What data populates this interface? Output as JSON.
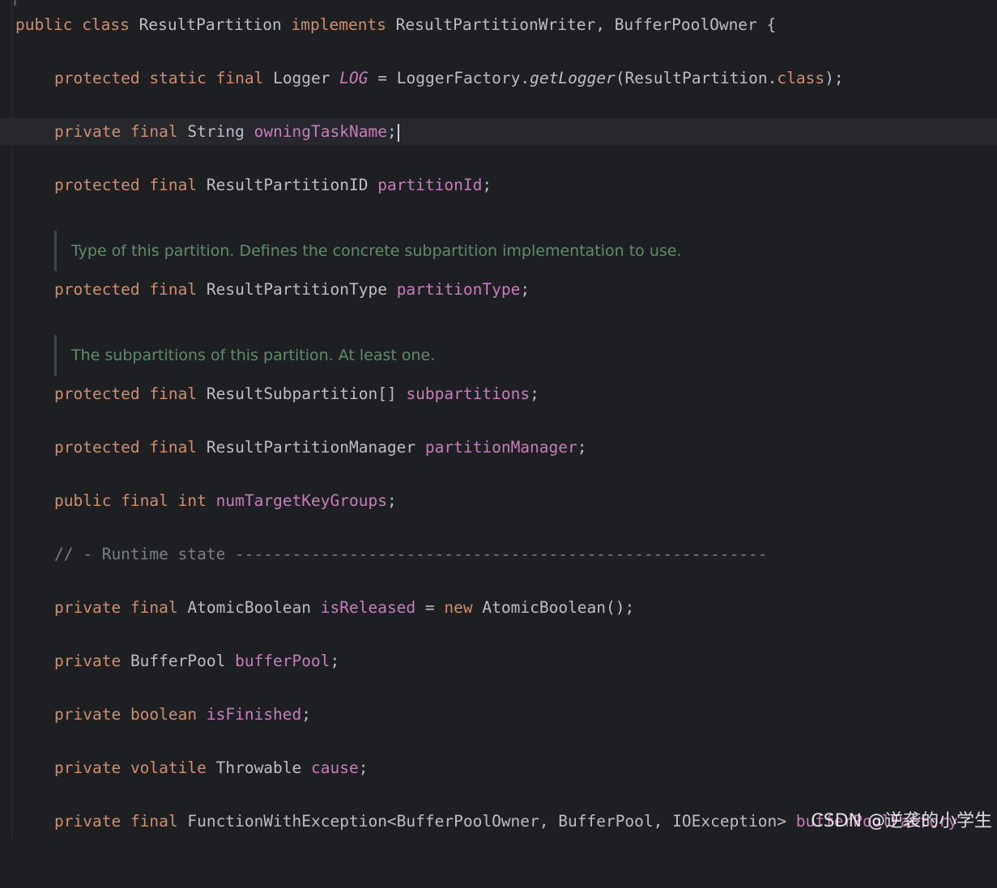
{
  "editor": {
    "l1": {
      "a": "public",
      "b": "class",
      "c": "ResultPartition",
      "d": "implements",
      "e": "ResultPartitionWriter, BufferPoolOwner {"
    },
    "l2": {
      "a": "protected",
      "b": "static",
      "c": "final",
      "d": "Logger",
      "e": "LOG",
      "f": "=",
      "g": "LoggerFactory.",
      "h": "getLogger",
      "i": "(ResultPartition.",
      "j": "class",
      "k": ");"
    },
    "l3": {
      "a": "private",
      "b": "final",
      "c": "String",
      "d": "owningTaskName",
      "e": ";"
    },
    "l4": {
      "a": "protected",
      "b": "final",
      "c": "ResultPartitionID",
      "d": "partitionId",
      "e": ";"
    },
    "doc1": "Type of this partition. Defines the concrete subpartition implementation to use.",
    "l5": {
      "a": "protected",
      "b": "final",
      "c": "ResultPartitionType",
      "d": "partitionType",
      "e": ";"
    },
    "doc2": "The subpartitions of this partition. At least one.",
    "l6": {
      "a": "protected",
      "b": "final",
      "c": "ResultSubpartition[]",
      "d": "subpartitions",
      "e": ";"
    },
    "l7": {
      "a": "protected",
      "b": "final",
      "c": "ResultPartitionManager",
      "d": "partitionManager",
      "e": ";"
    },
    "l8": {
      "a": "public",
      "b": "final",
      "c": "int",
      "d": "numTargetKeyGroups",
      "e": ";"
    },
    "l9": "// - Runtime state --------------------------------------------------------",
    "l10": {
      "a": "private",
      "b": "final",
      "c": "AtomicBoolean",
      "d": "isReleased",
      "e": "=",
      "f": "new",
      "g": "AtomicBoolean();"
    },
    "l11": {
      "a": "private",
      "b": "BufferPool",
      "c": "bufferPool",
      "d": ";"
    },
    "l12": {
      "a": "private",
      "b": "boolean",
      "c": "isFinished",
      "d": ";"
    },
    "l13": {
      "a": "private",
      "b": "volatile",
      "c": "Throwable",
      "d": "cause",
      "e": ";"
    },
    "l14": {
      "a": "private",
      "b": "final",
      "c": "FunctionWithException<BufferPoolOwner, BufferPool, IOException>",
      "d": "bufferPoolFactory"
    }
  },
  "watermark": "CSDN @逆袭的小学生",
  "colors": {
    "background": "#1e1f22",
    "keyword": "#cf8e6d",
    "field": "#c77dbb",
    "comment": "#7a7e85",
    "doc": "#5f8c6a",
    "text": "#bcbec4"
  }
}
